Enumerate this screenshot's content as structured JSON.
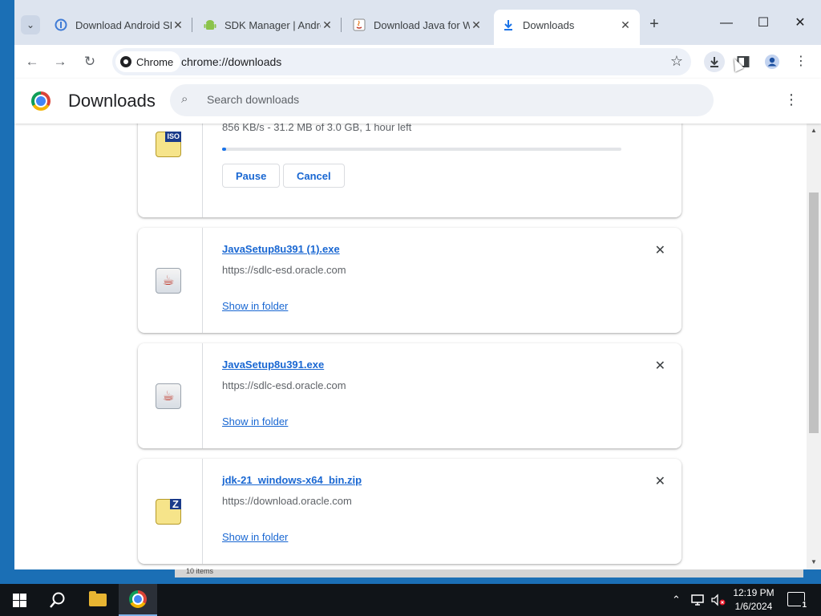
{
  "tabs": [
    {
      "title": "Download Android SDK",
      "favicon": "android-studio-icon",
      "active": false
    },
    {
      "title": "SDK Manager | Android",
      "favicon": "android-robot-icon",
      "active": false
    },
    {
      "title": "Download Java for Windows",
      "favicon": "java-icon",
      "active": false
    },
    {
      "title": "Downloads",
      "favicon": "download-icon",
      "active": true
    }
  ],
  "toolbar": {
    "chip_label": "Chrome",
    "url": "chrome://downloads"
  },
  "downloads_page": {
    "title": "Downloads",
    "search_placeholder": "Search downloads"
  },
  "in_progress": {
    "status": "856 KB/s - 31.2 MB of 3.0 GB, 1 hour left",
    "progress_fraction": 0.01,
    "pause_label": "Pause",
    "cancel_label": "Cancel",
    "icon_badge": "ISO"
  },
  "items": [
    {
      "name": "JavaSetup8u391 (1).exe",
      "source": "https://sdlc-esd.oracle.com",
      "action": "Show in folder",
      "icon": "java-file-icon"
    },
    {
      "name": "JavaSetup8u391.exe",
      "source": "https://sdlc-esd.oracle.com",
      "action": "Show in folder",
      "icon": "java-file-icon"
    },
    {
      "name": "jdk-21_windows-x64_bin.zip",
      "source": "https://download.oracle.com",
      "action": "Show in folder",
      "icon": "zip-file-icon",
      "icon_badge": "Z"
    }
  ],
  "behind_window": {
    "status_text": "10 items"
  },
  "taskbar": {
    "time": "12:19 PM",
    "date": "1/6/2024",
    "notification_count": "1"
  },
  "colors": {
    "accent": "#1a73e8",
    "link": "#1967d2",
    "tabstrip": "#dde4ef",
    "taskbar": "#101418"
  }
}
